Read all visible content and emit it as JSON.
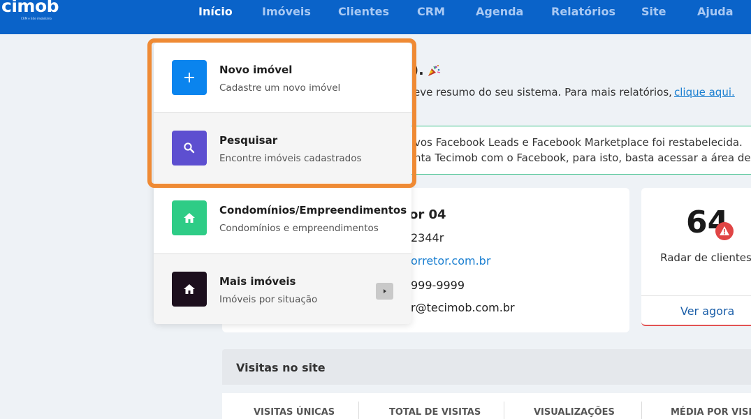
{
  "header": {
    "logo_text": "cimob",
    "logo_tagline": "CRM e Site imobiliário",
    "nav": [
      {
        "label": "Início",
        "active": true
      },
      {
        "label": "Imóveis"
      },
      {
        "label": "Clientes"
      },
      {
        "label": "CRM"
      },
      {
        "label": "Agenda"
      },
      {
        "label": "Relatórios"
      },
      {
        "label": "Site"
      },
      {
        "label": "Ajuda"
      }
    ]
  },
  "dashboard": {
    "greeting": ").",
    "summary_text": "eve resumo do seu sistema. Para mais relatórios,",
    "summary_link": "clique aqui.",
    "alert_line1": "vos Facebook Leads e Facebook Marketplace foi restabelecida.",
    "alert_line2": "nta Tecimob com o Facebook, para isto, basta acessar a área de int",
    "profile": {
      "name": "or 04",
      "creci": "2344r",
      "site": "orretor.com.br",
      "phone": "999-9999",
      "email": "r@tecimob.com.br"
    },
    "radar": {
      "count": "64",
      "label": "Radar de clientes",
      "link": "Ver agora"
    },
    "visits": {
      "title": "Visitas no site",
      "columns": [
        "VISITAS ÚNICAS",
        "TOTAL DE VISITAS",
        "VISUALIZAÇÕES",
        "MÉDIA POR VISITA"
      ]
    }
  },
  "dropdown": {
    "items": [
      {
        "title": "Novo imóvel",
        "subtitle": "Cadastre um novo imóvel",
        "icon": "plus-icon",
        "color": "#0a84ee"
      },
      {
        "title": "Pesquisar",
        "subtitle": "Encontre imóveis cadastrados",
        "icon": "search-icon",
        "color": "#5d4fd0"
      },
      {
        "title": "Condomínios/Empreendimentos",
        "subtitle": "Condomínios e empreendimentos",
        "icon": "home-icon",
        "color": "#2ecc86"
      },
      {
        "title": "Mais imóveis",
        "subtitle": "Imóveis por situação",
        "icon": "home-icon",
        "color": "#1c0f1d"
      }
    ]
  },
  "colors": {
    "nav_bg": "#0a63c9",
    "highlight": "#ef8a34",
    "link": "#1a7fd1",
    "alert_border": "#3cc08a",
    "radar_accent": "#e04545"
  }
}
